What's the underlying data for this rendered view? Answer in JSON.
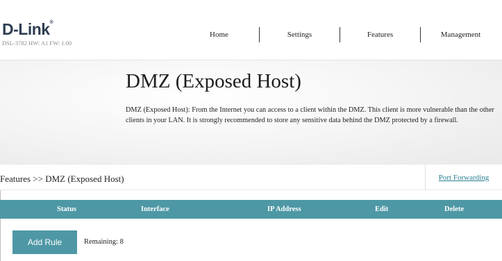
{
  "header": {
    "logo_text": "D-Link",
    "logo_mark": "®",
    "hw_info": "DSL-3782  HW: A1  FW: 1.00",
    "nav": [
      "Home",
      "Settings",
      "Features",
      "Management"
    ]
  },
  "banner": {
    "title": "DMZ (Exposed Host)",
    "description": "DMZ (Exposed Host): From the Internet you can access to a client within the DMZ. This client is more vulnerable than the other clients in your LAN. It is strongly recommended to store any sensitive data behind the DMZ protected by a firewall."
  },
  "breadcrumb": {
    "text": "Features >> DMZ (Exposed Host)",
    "link": "Port Forwarding"
  },
  "table": {
    "columns": [
      "Status",
      "Interface",
      "IP Address",
      "Edit",
      "Delete"
    ]
  },
  "actions": {
    "add_rule_label": "Add Rule",
    "remaining_label": "Remaining: 8"
  },
  "colors": {
    "accent": "#4e98a5",
    "link": "#2a7f93",
    "logo": "#2f3e52"
  }
}
